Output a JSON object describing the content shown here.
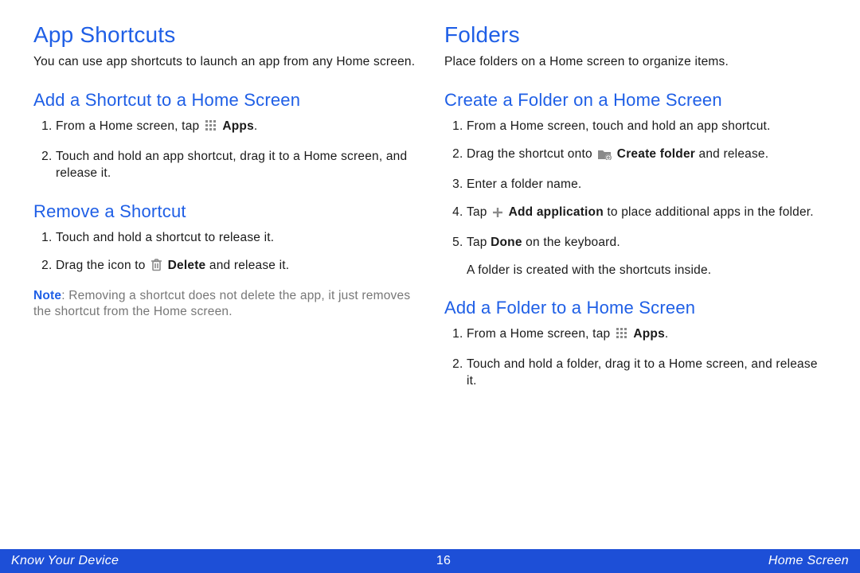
{
  "left": {
    "h1": "App Shortcuts",
    "intro": "You can use app shortcuts to launch an app from any Home screen.",
    "add": {
      "h2": "Add a Shortcut to a Home Screen",
      "li1a": "From a Home screen, tap ",
      "li1b": "Apps",
      "li1c": ".",
      "li2": "Touch and hold an app shortcut, drag it to a Home screen, and release it."
    },
    "remove": {
      "h2": "Remove a Shortcut",
      "li1": "Touch and hold a shortcut to release it.",
      "li2a": "Drag the icon to ",
      "li2b": "Delete",
      "li2c": " and release it.",
      "note_label": "Note",
      "note_body": ": Removing a shortcut does not delete the app, it just removes the shortcut from the Home screen."
    }
  },
  "right": {
    "h1": "Folders",
    "intro": "Place folders on a Home screen to organize items.",
    "create": {
      "h2": "Create a Folder on a Home Screen",
      "li1": "From a Home screen, touch and hold an app shortcut.",
      "li2a": "Drag the shortcut onto ",
      "li2b": "Create folder",
      "li2c": " and release.",
      "li3": "Enter a folder name.",
      "li4a": "Tap ",
      "li4b": "Add application",
      "li4c": " to place additional apps in the folder.",
      "li5a": "Tap ",
      "li5b": "Done",
      "li5c": " on the keyboard.",
      "after": "A folder is created with the shortcuts inside."
    },
    "addfolder": {
      "h2": "Add a Folder to a Home Screen",
      "li1a": "From a Home screen, tap ",
      "li1b": "Apps",
      "li1c": ".",
      "li2": "Touch and hold a folder, drag it to a Home screen, and release it."
    }
  },
  "footer": {
    "left": "Know Your Device",
    "page": "16",
    "right": "Home Screen"
  }
}
